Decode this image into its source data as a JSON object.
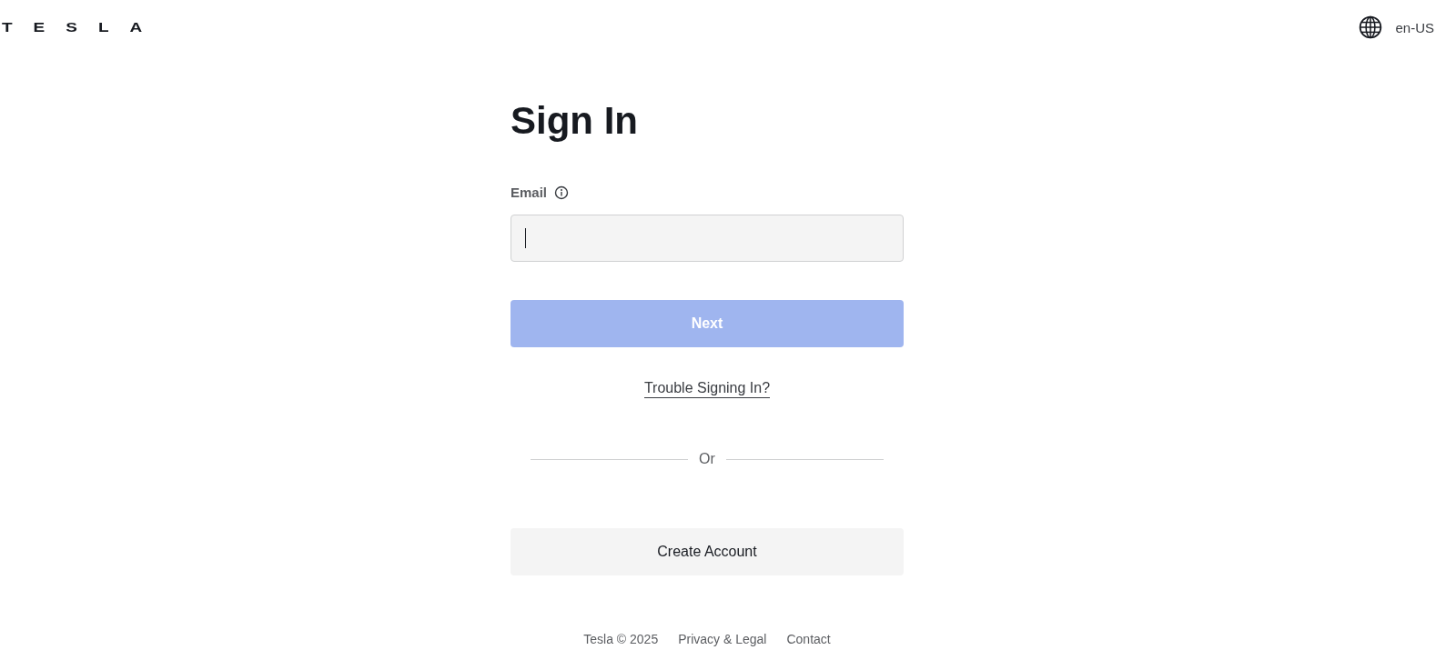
{
  "header": {
    "logo": "TESLA",
    "language": "en-US"
  },
  "title": "Sign In",
  "email": {
    "label": "Email"
  },
  "next_button": {
    "label": "Next",
    "disabled": true
  },
  "trouble_link": "Trouble Signing In?",
  "divider_text": "Or",
  "create_account_button": "Create Account",
  "footer": [
    "Tesla © 2025",
    "Privacy & Legal",
    "Contact"
  ]
}
